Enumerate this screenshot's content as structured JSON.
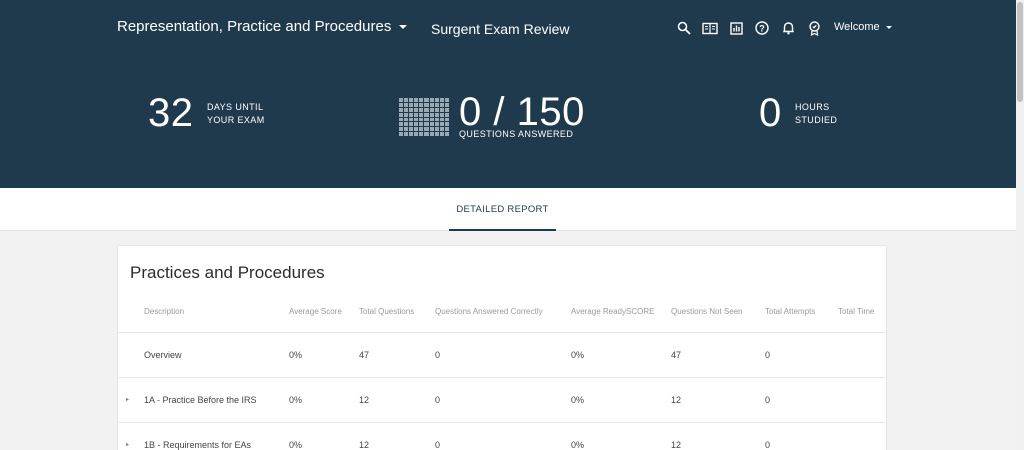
{
  "header": {
    "course": "Representation, Practice and Procedures",
    "brand": "Surgent Exam Review",
    "welcome": "Welcome",
    "icons": [
      "search-icon",
      "book-icon",
      "chart-icon",
      "help-icon",
      "bell-icon",
      "badge-icon"
    ]
  },
  "stats": {
    "days_value": "32",
    "days_line1": "DAYS UNTIL",
    "days_line2": "YOUR EXAM",
    "questions_value": "0 / 150",
    "questions_label": "QUESTIONS ANSWERED",
    "hours_value": "0",
    "hours_line1": "HOURS",
    "hours_line2": "STUDIED"
  },
  "tabs": {
    "detailed_report": "DETAILED REPORT"
  },
  "card": {
    "title": "Practices and Procedures",
    "columns": [
      "Description",
      "Average Score",
      "Total Questions",
      "Questions Answered Correctly",
      "Average ReadySCORE",
      "Questions Not Seen",
      "Total Attempts",
      "Total Time"
    ],
    "rows": [
      [
        "Overview",
        "0%",
        "47",
        "0",
        "0%",
        "47",
        "0",
        ""
      ],
      [
        "1A - Practice Before the IRS",
        "0%",
        "12",
        "0",
        "0%",
        "12",
        "0",
        ""
      ],
      [
        "1B - Requirements for EAs",
        "0%",
        "12",
        "0",
        "0%",
        "12",
        "0",
        ""
      ]
    ]
  },
  "colors": {
    "header_bg": "#1f3a4d",
    "page_bg": "#f2f2f2"
  }
}
